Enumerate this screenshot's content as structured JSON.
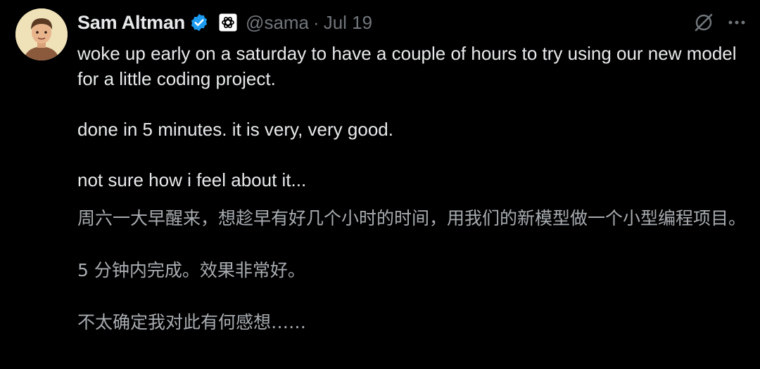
{
  "author": {
    "name": "Sam Altman",
    "handle": "@sama",
    "separator": "·",
    "date": "Jul 19",
    "verified_color": "#1d9bf0"
  },
  "tweet": {
    "paragraphs": [
      "woke up early on a saturday to have a couple of hours to try using our new model for a little coding project.",
      "done in 5 minutes. it is very, very good.",
      "not sure how i feel about it..."
    ]
  },
  "translation": {
    "paragraphs": [
      "周六一大早醒来，想趁早有好几个小时的时间，用我们的新模型做一个小型编程项目。",
      "5 分钟内完成。效果非常好。",
      "不太确定我对此有何感想……"
    ]
  },
  "icons": {
    "verified": "verified-badge-icon",
    "affiliation": "openai-logo-icon",
    "grok": "grok-icon",
    "more": "more-options-icon"
  },
  "colors": {
    "background": "#000000",
    "text": "#e7e9ea",
    "secondary": "#71767b",
    "translation_text": "#a8acb0"
  }
}
